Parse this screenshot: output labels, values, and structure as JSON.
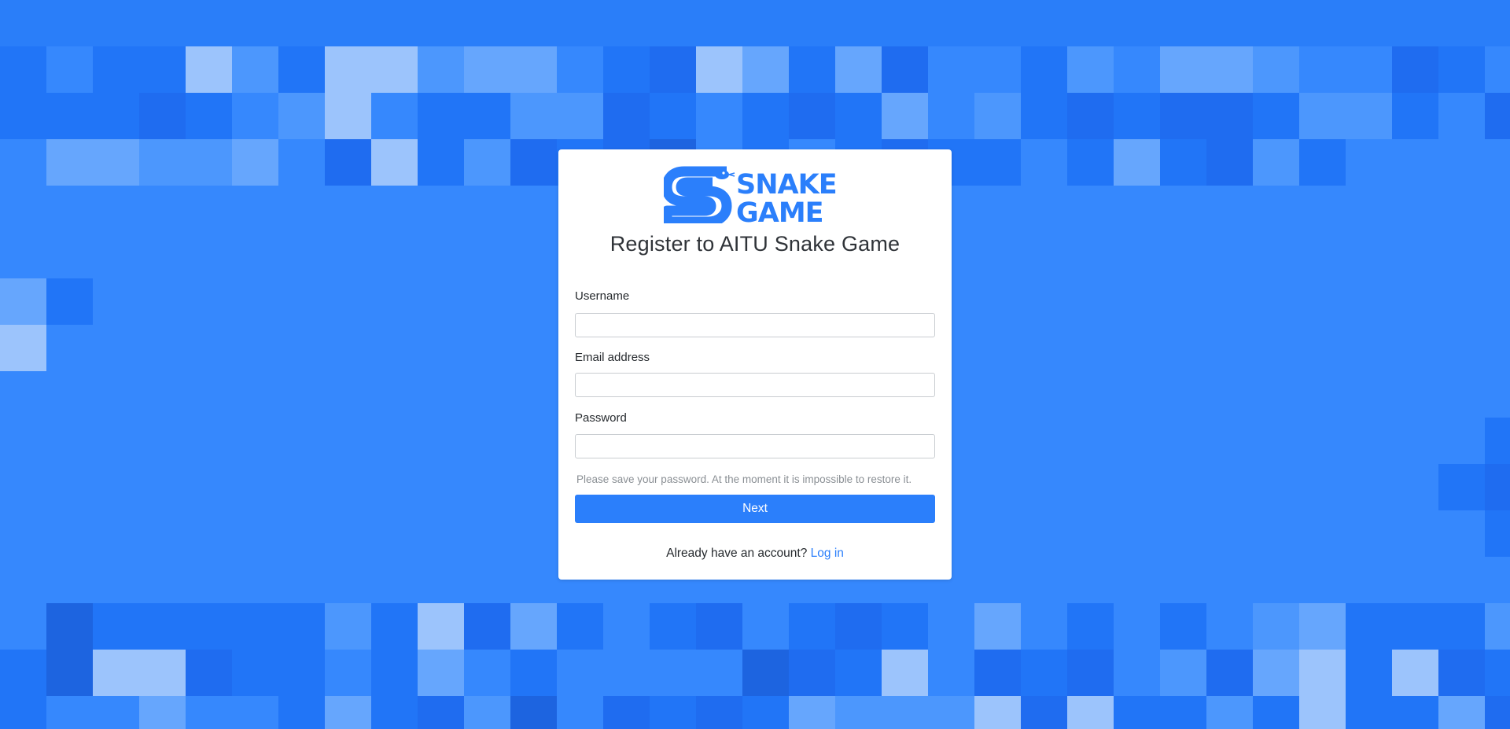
{
  "colors": {
    "background": "#3688fd",
    "accent": "#2b7ffb",
    "card": "#ffffff"
  },
  "logo": {
    "line1": "SNAKE",
    "line2": "GAME"
  },
  "form": {
    "title": "Register to AITU Snake Game",
    "username_label": "Username",
    "username_value": "",
    "email_label": "Email address",
    "email_value": "",
    "password_label": "Password",
    "password_value": "",
    "hint": "Please save your password. At the moment it is impossible to restore it.",
    "next_label": "Next",
    "login_prompt": "Already have an account?",
    "login_link": "Log in"
  },
  "icons": [
    "snake-logo-icon"
  ]
}
